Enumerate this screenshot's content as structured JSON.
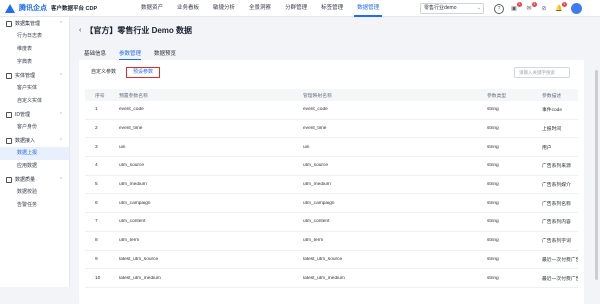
{
  "header": {
    "brand_name": "腾讯企点",
    "product_name": "客户数据平台 CDP",
    "nav": [
      {
        "label": "数据资产"
      },
      {
        "label": "业务看板"
      },
      {
        "label": "敏捷分析"
      },
      {
        "label": "全景洞察"
      },
      {
        "label": "分群管理"
      },
      {
        "label": "标签管理"
      },
      {
        "label": "数据管理",
        "active": true
      }
    ],
    "tenant_select": "零售行业demo",
    "icons": [
      {
        "name": "help-icon",
        "glyph": "?"
      },
      {
        "name": "notice-icon",
        "glyph": "▣",
        "badge": "1"
      },
      {
        "name": "message-icon",
        "glyph": "✉",
        "badge": "1"
      },
      {
        "name": "compass-icon",
        "glyph": "⊘"
      },
      {
        "name": "bell-icon",
        "glyph": "🔔",
        "badge": "1"
      }
    ]
  },
  "sidebar": {
    "sections": [
      {
        "title": "数据集管理",
        "icon": "database-icon",
        "items": [
          "行为日志表",
          "维度表",
          "字典表"
        ]
      },
      {
        "title": "实体管理",
        "icon": "entity-icon",
        "items": [
          "客户实体",
          "自定义实体"
        ]
      },
      {
        "title": "ID管理",
        "icon": "id-icon",
        "items": [
          "客户身份"
        ]
      },
      {
        "title": "数据接入",
        "icon": "import-icon",
        "items": [
          "数据上报",
          "应用数据"
        ]
      },
      {
        "title": "数据质量",
        "icon": "quality-icon",
        "items": [
          "数据校验",
          "告警任务"
        ]
      }
    ],
    "active_item": "数据上报"
  },
  "main": {
    "title": "【官方】零售行业 Demo 数据",
    "tabs": [
      {
        "label": "基础信息"
      },
      {
        "label": "参数管理",
        "active": true
      },
      {
        "label": "数据预览"
      }
    ],
    "subtabs": [
      {
        "label": "自定义参数"
      },
      {
        "label": "预设参数",
        "active": true
      }
    ],
    "search_placeholder": "请输入关键字搜索",
    "columns": [
      "序号",
      "预置参数名称",
      "管理映射名称",
      "参数类型",
      "参数描述"
    ],
    "rows": [
      [
        "1",
        "event_code",
        "event_code",
        "string",
        "事件code"
      ],
      [
        "2",
        "event_time",
        "event_time",
        "string",
        "上报时间"
      ],
      [
        "3",
        "uin",
        "uin",
        "string",
        "用户"
      ],
      [
        "4",
        "utm_source",
        "utm_source",
        "string",
        "广告系列来源"
      ],
      [
        "5",
        "utm_medium",
        "utm_medium",
        "string",
        "广告系列媒介"
      ],
      [
        "6",
        "utm_campaign",
        "utm_campaign",
        "string",
        "广告系列名称"
      ],
      [
        "7",
        "utm_content",
        "utm_content",
        "string",
        "广告系列内容"
      ],
      [
        "8",
        "utm_term",
        "utm_term",
        "string",
        "广告系列字词"
      ],
      [
        "9",
        "latest_utm_source",
        "latest_utm_source",
        "string",
        "最近一次付费广告系列"
      ],
      [
        "10",
        "latest_utm_medium",
        "latest_utm_medium",
        "string",
        "最近一次付费广告系列"
      ]
    ]
  },
  "colors": {
    "accent": "#1f6df2",
    "highlight_border": "#d9302f"
  }
}
